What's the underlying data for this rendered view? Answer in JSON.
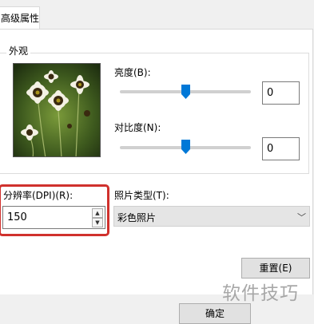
{
  "tab": {
    "label": "高级属性"
  },
  "appearance": {
    "legend": "外观",
    "brightness": {
      "label": "亮度(B):",
      "value": "0",
      "level": 0.5
    },
    "contrast": {
      "label": "对比度(N):",
      "value": "0",
      "level": 0.5
    }
  },
  "resolution": {
    "label": "分辨率(DPI)(R):",
    "value": "150"
  },
  "picture_type": {
    "label": "照片类型(T):",
    "selected": "彩色照片"
  },
  "buttons": {
    "reset": "重置(E)",
    "ok": "确定"
  },
  "watermark": "软件技巧",
  "colors": {
    "accent": "#0078d7",
    "highlight_border": "#d0312d"
  }
}
